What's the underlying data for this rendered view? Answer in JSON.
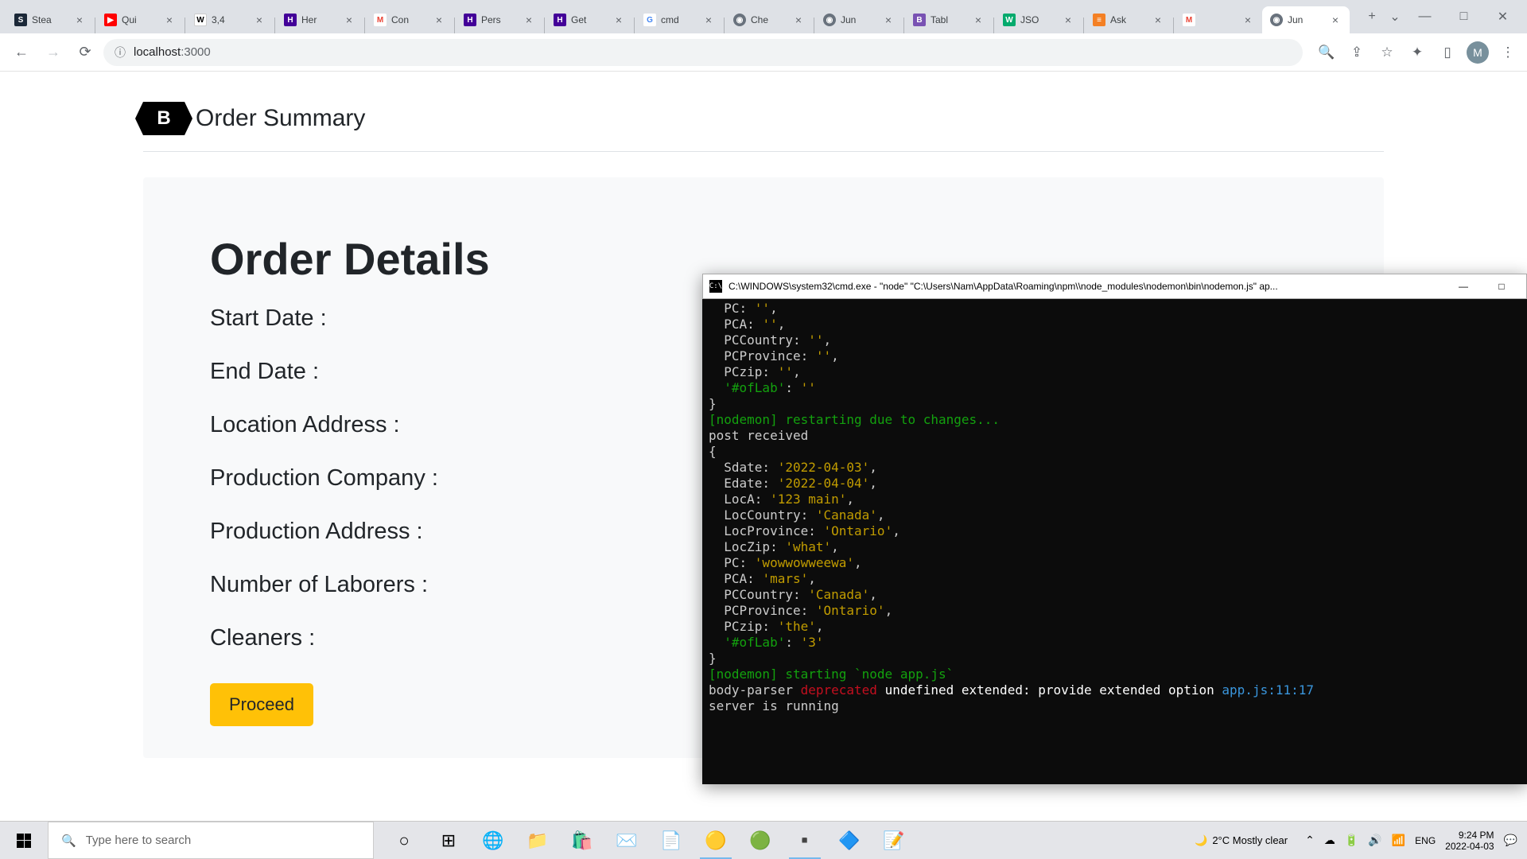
{
  "browser": {
    "url_host": "localhost",
    "url_path": ":3000",
    "tabs": [
      {
        "label": "Stea",
        "favicon": "fav-steam",
        "letter": "S"
      },
      {
        "label": "Qui",
        "favicon": "fav-yt",
        "letter": "▶"
      },
      {
        "label": "3,4",
        "favicon": "fav-wiki",
        "letter": "W"
      },
      {
        "label": "Her",
        "favicon": "fav-heroku",
        "letter": "H"
      },
      {
        "label": "Con",
        "favicon": "fav-gmail",
        "letter": "M"
      },
      {
        "label": "Pers",
        "favicon": "fav-heroku",
        "letter": "H"
      },
      {
        "label": "Get",
        "favicon": "fav-heroku",
        "letter": "H"
      },
      {
        "label": "cmd",
        "favicon": "fav-google",
        "letter": "G"
      },
      {
        "label": "Che",
        "favicon": "fav-globe",
        "letter": "◉"
      },
      {
        "label": "Jun",
        "favicon": "fav-globe",
        "letter": "◉"
      },
      {
        "label": "Tabl",
        "favicon": "fav-boot",
        "letter": "B"
      },
      {
        "label": "JSO",
        "favicon": "fav-w3",
        "letter": "W"
      },
      {
        "label": "Ask",
        "favicon": "fav-so",
        "letter": "≡"
      },
      {
        "label": "",
        "favicon": "fav-gmail",
        "letter": "M"
      },
      {
        "label": "Jun",
        "favicon": "fav-globe",
        "letter": "◉",
        "active": true
      }
    ],
    "avatar": "M"
  },
  "page": {
    "title": "Order Summary",
    "heading": "Order Details",
    "fields": [
      "Start Date :",
      "End Date :",
      "Location Address :",
      "Production Company :",
      "Production Address :",
      "Number of Laborers :",
      "Cleaners :"
    ],
    "button": "Proceed"
  },
  "cmd": {
    "title": "C:\\WINDOWS\\system32\\cmd.exe  - \"node\"   \"C:\\Users\\Nam\\AppData\\Roaming\\npm\\\\node_modules\\nodemon\\bin\\nodemon.js\" ap...",
    "lines": [
      [
        {
          "c": "c-w",
          "t": "  PC: "
        },
        {
          "c": "c-y",
          "t": "''"
        },
        {
          "c": "c-w",
          "t": ","
        }
      ],
      [
        {
          "c": "c-w",
          "t": "  PCA: "
        },
        {
          "c": "c-y",
          "t": "''"
        },
        {
          "c": "c-w",
          "t": ","
        }
      ],
      [
        {
          "c": "c-w",
          "t": "  PCCountry: "
        },
        {
          "c": "c-y",
          "t": "''"
        },
        {
          "c": "c-w",
          "t": ","
        }
      ],
      [
        {
          "c": "c-w",
          "t": "  PCProvince: "
        },
        {
          "c": "c-y",
          "t": "''"
        },
        {
          "c": "c-w",
          "t": ","
        }
      ],
      [
        {
          "c": "c-w",
          "t": "  PCzip: "
        },
        {
          "c": "c-y",
          "t": "''"
        },
        {
          "c": "c-w",
          "t": ","
        }
      ],
      [
        {
          "c": "c-g",
          "t": "  '#ofLab'"
        },
        {
          "c": "c-w",
          "t": ": "
        },
        {
          "c": "c-y",
          "t": "''"
        }
      ],
      [
        {
          "c": "c-w",
          "t": "}"
        }
      ],
      [
        {
          "c": "c-g",
          "t": "[nodemon] restarting due to changes..."
        }
      ],
      [
        {
          "c": "c-w",
          "t": "post received"
        }
      ],
      [
        {
          "c": "c-w",
          "t": "{"
        }
      ],
      [
        {
          "c": "c-w",
          "t": "  Sdate: "
        },
        {
          "c": "c-y",
          "t": "'2022-04-03'"
        },
        {
          "c": "c-w",
          "t": ","
        }
      ],
      [
        {
          "c": "c-w",
          "t": "  Edate: "
        },
        {
          "c": "c-y",
          "t": "'2022-04-04'"
        },
        {
          "c": "c-w",
          "t": ","
        }
      ],
      [
        {
          "c": "c-w",
          "t": "  LocA: "
        },
        {
          "c": "c-y",
          "t": "'123 main'"
        },
        {
          "c": "c-w",
          "t": ","
        }
      ],
      [
        {
          "c": "c-w",
          "t": "  LocCountry: "
        },
        {
          "c": "c-y",
          "t": "'Canada'"
        },
        {
          "c": "c-w",
          "t": ","
        }
      ],
      [
        {
          "c": "c-w",
          "t": "  LocProvince: "
        },
        {
          "c": "c-y",
          "t": "'Ontario'"
        },
        {
          "c": "c-w",
          "t": ","
        }
      ],
      [
        {
          "c": "c-w",
          "t": "  LocZip: "
        },
        {
          "c": "c-y",
          "t": "'what'"
        },
        {
          "c": "c-w",
          "t": ","
        }
      ],
      [
        {
          "c": "c-w",
          "t": "  PC: "
        },
        {
          "c": "c-y",
          "t": "'wowwowweewa'"
        },
        {
          "c": "c-w",
          "t": ","
        }
      ],
      [
        {
          "c": "c-w",
          "t": "  PCA: "
        },
        {
          "c": "c-y",
          "t": "'mars'"
        },
        {
          "c": "c-w",
          "t": ","
        }
      ],
      [
        {
          "c": "c-w",
          "t": "  PCCountry: "
        },
        {
          "c": "c-y",
          "t": "'Canada'"
        },
        {
          "c": "c-w",
          "t": ","
        }
      ],
      [
        {
          "c": "c-w",
          "t": "  PCProvince: "
        },
        {
          "c": "c-y",
          "t": "'Ontario'"
        },
        {
          "c": "c-w",
          "t": ","
        }
      ],
      [
        {
          "c": "c-w",
          "t": "  PCzip: "
        },
        {
          "c": "c-y",
          "t": "'the'"
        },
        {
          "c": "c-w",
          "t": ","
        }
      ],
      [
        {
          "c": "c-g",
          "t": "  '#ofLab'"
        },
        {
          "c": "c-w",
          "t": ": "
        },
        {
          "c": "c-y",
          "t": "'3'"
        }
      ],
      [
        {
          "c": "c-w",
          "t": "}"
        }
      ],
      [
        {
          "c": "c-g",
          "t": "[nodemon] starting `node app.js`"
        }
      ],
      [
        {
          "c": "c-w",
          "t": "body-parser "
        },
        {
          "c": "c-r",
          "t": "deprecated "
        },
        {
          "c": "c-wt",
          "t": "undefined extended: provide extended option "
        },
        {
          "c": "c-c",
          "t": "app.js:11:17"
        }
      ],
      [
        {
          "c": "c-w",
          "t": "server is running"
        }
      ]
    ]
  },
  "taskbar": {
    "search_placeholder": "Type here to search",
    "weather": "2°C  Mostly clear",
    "lang": "ENG",
    "time": "9:24 PM",
    "date": "2022-04-03"
  }
}
